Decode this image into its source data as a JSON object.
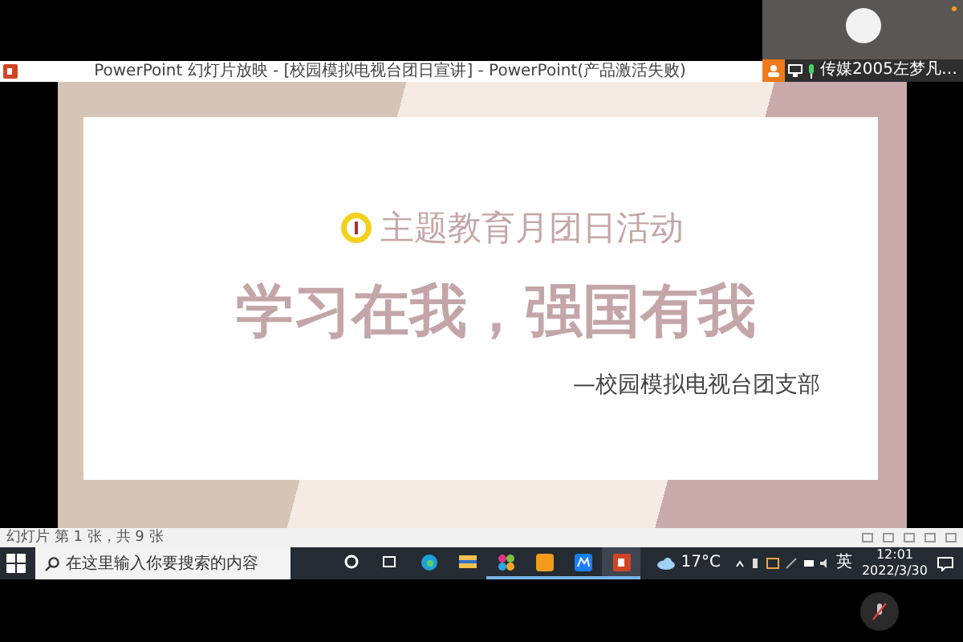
{
  "participant": {
    "name": "传媒2005左梦凡…",
    "mic_on": true
  },
  "window": {
    "title": "PowerPoint 幻灯片放映 - [校园模拟电视台团日宣讲] - PowerPoint(产品激活失败)"
  },
  "slide": {
    "subtitle": "主题教育月团日活动",
    "headline": "学习在我，强国有我",
    "byline": "—校园模拟电视台团支部"
  },
  "status_bar": {
    "text": "幻灯片 第 1 张，共 9 张"
  },
  "taskbar": {
    "search": {
      "placeholder": "在这里输入你要搜索的内容"
    },
    "apps": [
      {
        "kind": "cortana",
        "running": false,
        "selected": false
      },
      {
        "kind": "taskview",
        "running": false,
        "selected": false
      },
      {
        "kind": "edge",
        "running": false,
        "selected": false
      },
      {
        "kind": "explorer",
        "running": false,
        "selected": false
      },
      {
        "kind": "clover",
        "running": true,
        "selected": false
      },
      {
        "kind": "orange",
        "running": true,
        "selected": false
      },
      {
        "kind": "blue",
        "running": true,
        "selected": false
      },
      {
        "kind": "powerpoint",
        "running": true,
        "selected": true
      }
    ],
    "weather": "17°C",
    "ime": "英",
    "time": "12:01",
    "date": "2022/3/30"
  }
}
